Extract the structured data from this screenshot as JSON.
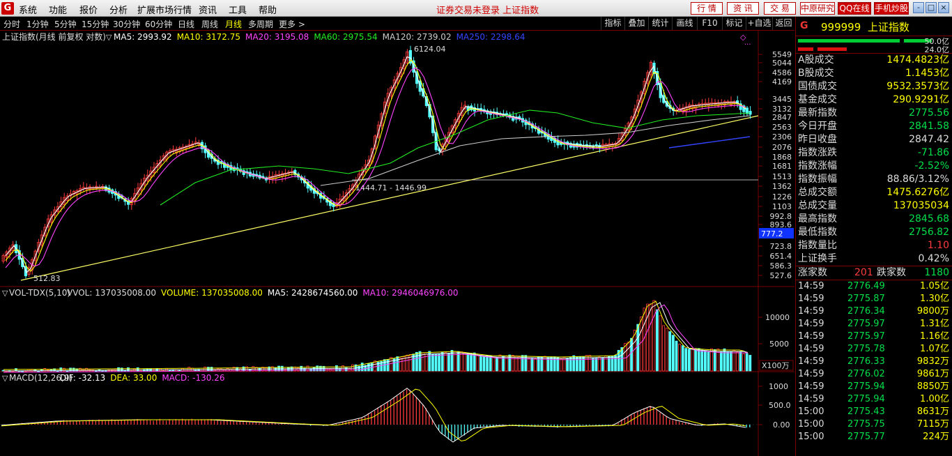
{
  "menubar": {
    "logo": "G",
    "items": [
      "系统",
      "功能",
      "报价",
      "分析",
      "扩展市场行情",
      "资讯",
      "工具",
      "帮助"
    ],
    "status": "证券交易未登录  上证指数",
    "right_buttons": [
      "行 情",
      "资 讯",
      "交 易",
      "中原研究",
      "QQ在线",
      "手机炒股"
    ],
    "window_buttons": [
      "-",
      "□",
      "×"
    ]
  },
  "toolbar": {
    "tabs": [
      "分时",
      "1分钟",
      "5分钟",
      "15分钟",
      "30分钟",
      "60分钟",
      "日线",
      "周线",
      "月线",
      "多周期",
      "更多 >"
    ],
    "active_tab": "月线",
    "tools": [
      "指标",
      "叠加",
      "统计",
      "画线",
      "F10",
      "标记",
      "+自选",
      "返回"
    ]
  },
  "main_chart": {
    "title": "上证指数(月线 前复权 对数)",
    "ma_labels": [
      {
        "text": "MA5: 2993.92",
        "color": "#ffffff"
      },
      {
        "text": "MA10: 3172.75",
        "color": "#ffff00"
      },
      {
        "text": "MA20: 3195.08",
        "color": "#ff44ff"
      },
      {
        "text": "MA60: 2975.54",
        "color": "#22ee22"
      },
      {
        "text": "MA120: 2739.02",
        "color": "#cccccc"
      },
      {
        "text": "MA250: 2298.64",
        "color": "#3344ff"
      }
    ],
    "y_ticks": [
      "5549",
      "5044",
      "4586",
      "4169",
      "3445",
      "3132",
      "2847",
      "2563",
      "2306",
      "2076",
      "1868",
      "1681",
      "1513",
      "1362",
      "1226",
      "1103",
      "992.8",
      "893.6",
      "777.2",
      "723.8",
      "651.4",
      "586.3",
      "527.6"
    ],
    "current_price_label": "777.2",
    "annotations": {
      "high": "6124.04",
      "low": "512.83",
      "hline": "1444.71 - 1446.99"
    }
  },
  "volume_pane": {
    "indicator": "VOL-TDX(5,10)",
    "labels": [
      {
        "text": "VVOL: 137035008.00",
        "color": "#dddddd"
      },
      {
        "text": "VOLUME: 137035008.00",
        "color": "#ffff00"
      },
      {
        "text": "MA5: 2428674560.00",
        "color": "#ffffff"
      },
      {
        "text": "MA10: 2946046976.00",
        "color": "#ff44ff"
      }
    ],
    "y_ticks": [
      "10000",
      "5000"
    ],
    "unit": "X100万"
  },
  "macd_pane": {
    "indicator": "MACD(12,26,9)",
    "labels": [
      {
        "text": "DIF: -32.13",
        "color": "#ffffff"
      },
      {
        "text": "DEA: 33.00",
        "color": "#ffff00"
      },
      {
        "text": "MACD: -130.26",
        "color": "#ff44ff"
      }
    ],
    "y_ticks": [
      "1000",
      "500.0",
      "0.00"
    ]
  },
  "quote_panel": {
    "code": "999999",
    "name": "上证指数",
    "bar_rows": [
      {
        "value": "50.0亿",
        "color": "#00cc33"
      },
      {
        "value": "24.0亿",
        "color": "#dd1111"
      }
    ],
    "rows": [
      {
        "k": "A股成交",
        "v": "1474.4823亿",
        "c": "yel"
      },
      {
        "k": "B股成交",
        "v": "1.1453亿",
        "c": "yel"
      },
      {
        "k": "国债成交",
        "v": "9532.3573亿",
        "c": "yel"
      },
      {
        "k": "基金成交",
        "v": "290.9291亿",
        "c": "yel"
      },
      {
        "k": "最新指数",
        "v": "2775.56",
        "c": "fall"
      },
      {
        "k": "今日开盘",
        "v": "2841.58",
        "c": "fall"
      },
      {
        "k": "昨日收盘",
        "v": "2847.42",
        "c": "flat"
      },
      {
        "k": "指数涨跌",
        "v": "-71.86",
        "c": "fall"
      },
      {
        "k": "指数涨幅",
        "v": "-2.52%",
        "c": "fall"
      },
      {
        "k": "指数振幅",
        "v": "88.86/3.12%",
        "c": "flat"
      },
      {
        "k": "总成交额",
        "v": "1475.6276亿",
        "c": "yel"
      },
      {
        "k": "总成交量",
        "v": "137035034",
        "c": "yel"
      },
      {
        "k": "最高指数",
        "v": "2845.68",
        "c": "fall"
      },
      {
        "k": "最低指数",
        "v": "2756.82",
        "c": "fall"
      },
      {
        "k": "指数量比",
        "v": "1.10",
        "c": "rise"
      },
      {
        "k": "上证换手",
        "v": "0.42%",
        "c": "flat"
      }
    ],
    "breadth": {
      "up_label": "涨家数",
      "up": "201",
      "down_label": "跌家数",
      "down": "1180"
    },
    "ticks": [
      {
        "t": "14:59",
        "p": "2776.49",
        "v": "1.05亿"
      },
      {
        "t": "14:59",
        "p": "2775.87",
        "v": "1.30亿"
      },
      {
        "t": "14:59",
        "p": "2776.34",
        "v": "9800万"
      },
      {
        "t": "14:59",
        "p": "2775.97",
        "v": "1.31亿"
      },
      {
        "t": "14:59",
        "p": "2775.97",
        "v": "1.16亿"
      },
      {
        "t": "14:59",
        "p": "2775.78",
        "v": "1.07亿"
      },
      {
        "t": "14:59",
        "p": "2776.33",
        "v": "9832万"
      },
      {
        "t": "14:59",
        "p": "2776.02",
        "v": "9861万"
      },
      {
        "t": "14:59",
        "p": "2775.94",
        "v": "8850万"
      },
      {
        "t": "14:59",
        "p": "2775.94",
        "v": "1.00亿"
      },
      {
        "t": "15:00",
        "p": "2775.43",
        "v": "8631万"
      },
      {
        "t": "15:00",
        "p": "2775.75",
        "v": "7115万"
      },
      {
        "t": "15:00",
        "p": "2775.77",
        "v": "224万"
      }
    ]
  },
  "colors": {
    "up": "#ff3b3b",
    "down": "#54ffff",
    "ma5": "#ffffff",
    "ma10": "#ffff00",
    "ma20": "#ff44ff",
    "ma60": "#22ee22",
    "ma120": "#cccccc",
    "ma250": "#3344ff",
    "trend": "#ffff66"
  }
}
